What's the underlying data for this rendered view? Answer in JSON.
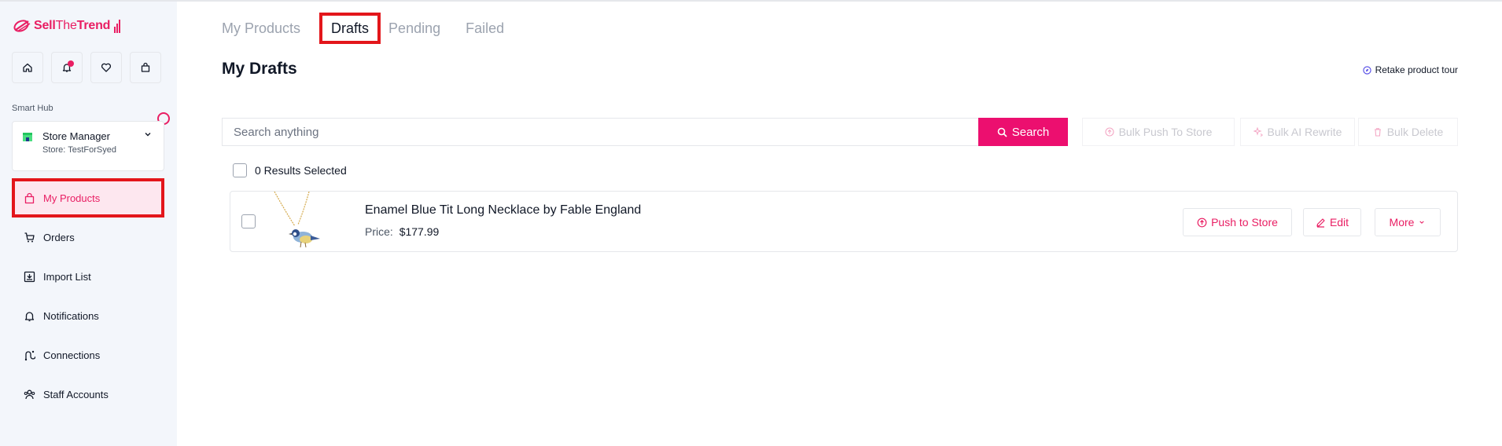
{
  "brand": {
    "name_bold": "Sell",
    "name_light": "The",
    "name_end": "Trend"
  },
  "colors": {
    "accent": "#e91e63",
    "highlight_border": "#e3161b",
    "sidebar_bg": "#f3f6fb"
  },
  "quick_icons": [
    "home-icon",
    "bell-icon",
    "heart-icon",
    "bag-icon"
  ],
  "sidebar": {
    "section_label": "Smart Hub",
    "store": {
      "title": "Store Manager",
      "subtitle": "Store: TestForSyed"
    },
    "items": [
      {
        "label": "My Products",
        "icon": "bag-icon",
        "active": true
      },
      {
        "label": "Orders",
        "icon": "cart-icon"
      },
      {
        "label": "Import List",
        "icon": "import-icon"
      },
      {
        "label": "Notifications",
        "icon": "bell-icon"
      },
      {
        "label": "Connections",
        "icon": "connections-icon"
      },
      {
        "label": "Staff Accounts",
        "icon": "users-icon"
      }
    ]
  },
  "tabs": [
    {
      "label": "My Products"
    },
    {
      "label": "Drafts",
      "active": true
    },
    {
      "label": "Pending"
    },
    {
      "label": "Failed"
    }
  ],
  "page": {
    "title": "My Drafts",
    "retake_tour": "Retake product tour"
  },
  "search": {
    "placeholder": "Search anything",
    "value": "",
    "button": "Search"
  },
  "bulk_actions": {
    "push": "Bulk Push To Store",
    "rewrite": "Bulk AI Rewrite",
    "delete": "Bulk Delete"
  },
  "selection": {
    "text": "0 Results Selected"
  },
  "products": [
    {
      "name": "Enamel Blue Tit Long Necklace by Fable England",
      "price_label": "Price:",
      "price": "$177.99",
      "actions": {
        "push": "Push to Store",
        "edit": "Edit",
        "more": "More"
      }
    }
  ]
}
